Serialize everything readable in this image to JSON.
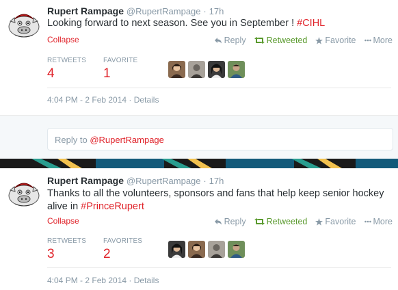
{
  "tweets": [
    {
      "fullname": "Rupert Rampage",
      "handle": "@RupertRampage",
      "dot": "·",
      "time": "17h",
      "text_before": "Looking forward to next season. See you in September ! ",
      "hashtag": "#CIHL",
      "text_after": "",
      "collapse": "Collapse",
      "actions": {
        "reply": "Reply",
        "retweet": "Retweeted",
        "favorite": "Favorite",
        "more": "More"
      },
      "stats": [
        {
          "label": "RETWEETS",
          "value": "4"
        },
        {
          "label": "FAVORITE",
          "value": "1"
        }
      ],
      "timestamp": "4:04 PM - 2 Feb 2014",
      "timestamp_sep": "·",
      "details": "Details"
    },
    {
      "fullname": "Rupert Rampage",
      "handle": "@RupertRampage",
      "dot": "·",
      "time": "17h",
      "text_before": "Thanks to all the volunteers, sponsors and fans that help keep senior hockey alive in ",
      "hashtag": "#PrinceRupert",
      "text_after": "",
      "collapse": "Collapse",
      "actions": {
        "reply": "Reply",
        "retweet": "Retweeted",
        "favorite": "Favorite",
        "more": "More"
      },
      "stats": [
        {
          "label": "RETWEETS",
          "value": "3"
        },
        {
          "label": "FAVORITES",
          "value": "2"
        }
      ],
      "timestamp": "4:04 PM - 2 Feb 2014",
      "timestamp_sep": "·",
      "details": "Details"
    }
  ],
  "reply": {
    "prefix": "Reply to ",
    "mention": "@RupertRampage"
  },
  "colors": {
    "accent": "#e0242b",
    "retweeted": "#5a9a2e",
    "muted": "#8899a6",
    "banner_teal": "#2a9d8f"
  },
  "icons": {
    "avatar": "angry-bull-team-logo",
    "reply": "reply-arrow-icon",
    "retweet": "retweet-icon",
    "favorite": "star-icon",
    "more": "more-dots-icon"
  }
}
